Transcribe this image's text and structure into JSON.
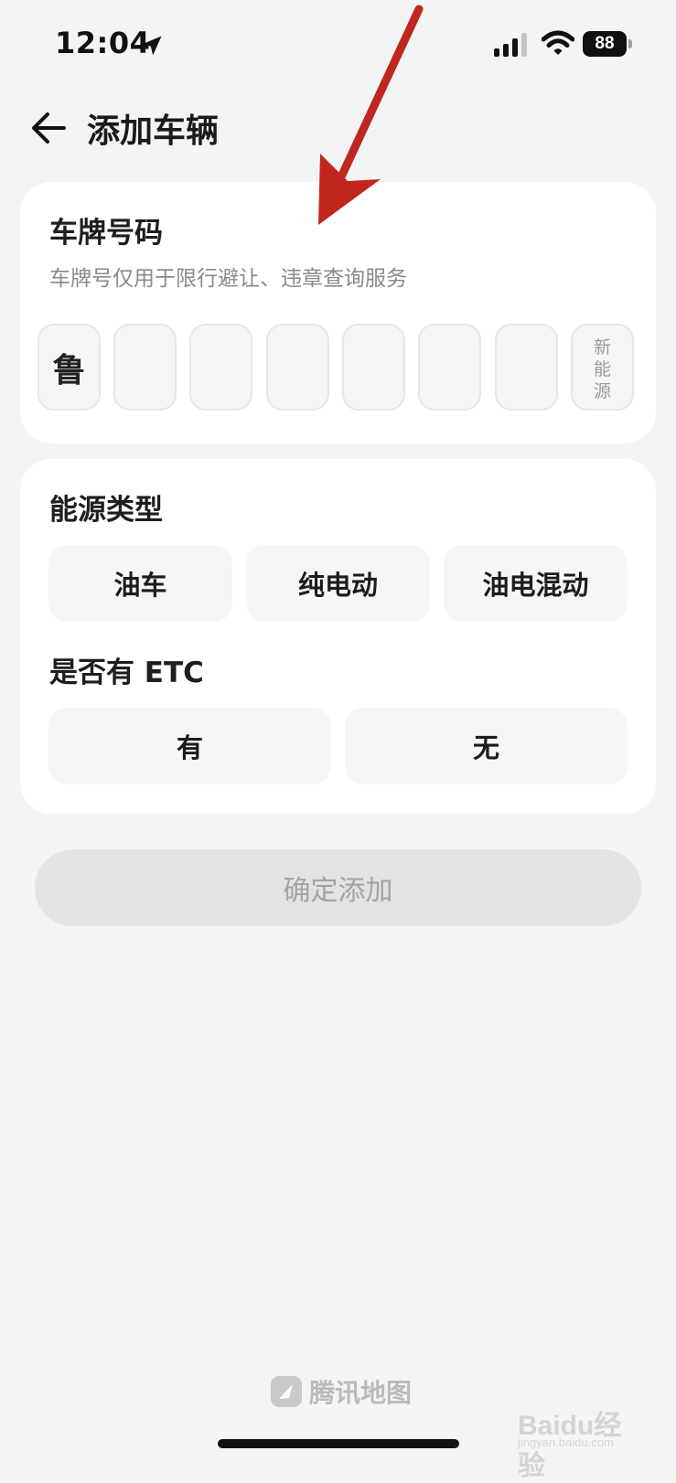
{
  "status_bar": {
    "time": "12:04",
    "battery": "88",
    "icons": [
      "location-arrow-icon",
      "signal-icon",
      "wifi-icon",
      "battery-icon"
    ]
  },
  "nav": {
    "back_icon": "arrow-left-icon",
    "title": "添加车辆"
  },
  "plate_section": {
    "title": "车牌号码",
    "subtitle": "车牌号仅用于限行避让、违章查询服务",
    "boxes": [
      "鲁",
      "",
      "",
      "",
      "",
      "",
      ""
    ],
    "new_energy_label": "新\n能\n源"
  },
  "type_section": {
    "energy_title": "能源类型",
    "energy_options": [
      "油车",
      "纯电动",
      "油电混动"
    ],
    "etc_title": "是否有 ETC",
    "etc_options": [
      "有",
      "无"
    ]
  },
  "confirm_label": "确定添加",
  "brand_label": "腾讯地图",
  "watermark": {
    "text": "Baidu经验",
    "sub": "jingyan.baidu.com"
  },
  "colors": {
    "background": "#f3f4f6",
    "card": "#ffffff",
    "option": "#f5f6f8",
    "confirm_disabled": "#e2e3e5",
    "annotation_arrow": "#c0261e"
  }
}
